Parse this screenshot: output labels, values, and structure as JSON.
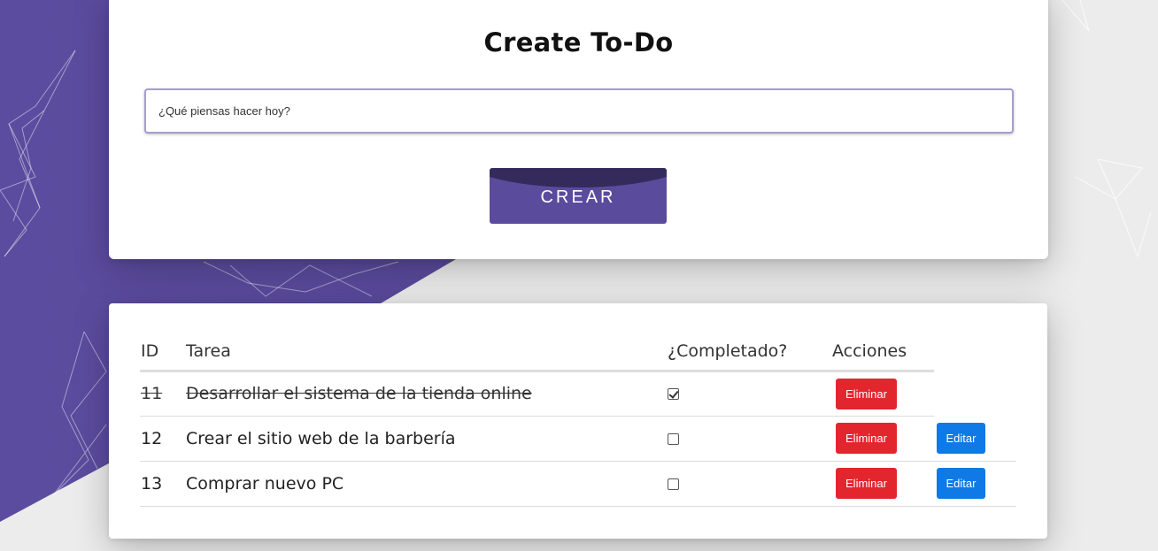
{
  "app": {
    "title": "Create To-Do"
  },
  "colors": {
    "primary": "#5b4b9c",
    "danger": "#e3262e",
    "info": "#0f7ae5",
    "background_purple": "#5a4a9e"
  },
  "create_form": {
    "input_placeholder": "¿Qué piensas hacer hoy?",
    "input_value": "",
    "submit_label": "CREAR"
  },
  "todo_table": {
    "headers": {
      "id": "ID",
      "task": "Tarea",
      "completed": "¿Completado?",
      "actions": "Acciones"
    },
    "rows": [
      {
        "id": "11",
        "task": "Desarrollar el sistema de la tienda online",
        "completed": true,
        "delete_label": "Eliminar",
        "edit_label": ""
      },
      {
        "id": "12",
        "task": "Crear el sitio web de la barbería",
        "completed": false,
        "delete_label": "Eliminar",
        "edit_label": "Editar"
      },
      {
        "id": "13",
        "task": "Comprar nuevo PC",
        "completed": false,
        "delete_label": "Eliminar",
        "edit_label": "Editar"
      }
    ]
  }
}
